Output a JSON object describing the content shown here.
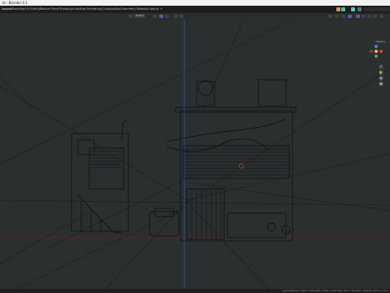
{
  "window": {
    "title": "bl - Blender 4.1"
  },
  "workspaces": [
    "Layout",
    "Modeling",
    "UV Editing",
    "Texture Paint",
    "Shading",
    "Animation",
    "Rendering",
    "Compositing",
    "Geometry Nodes",
    "Scripting"
  ],
  "workspace_active": "Layout",
  "header": {
    "orientation_label": "Global",
    "options_label": "Options"
  },
  "status": {
    "stats_text": "Light Detector | Verts: 4,051,000 | Faces: 3,517,000 | Tris: 7,103,000 | Objects: 0/153 | 4.1.0"
  },
  "colors": {
    "axis_x": "#d6453b",
    "axis_y": "#6aa62d",
    "axis_z": "#3d86d6",
    "wire": "#0b0d0e",
    "bg": "#2b2f30"
  }
}
